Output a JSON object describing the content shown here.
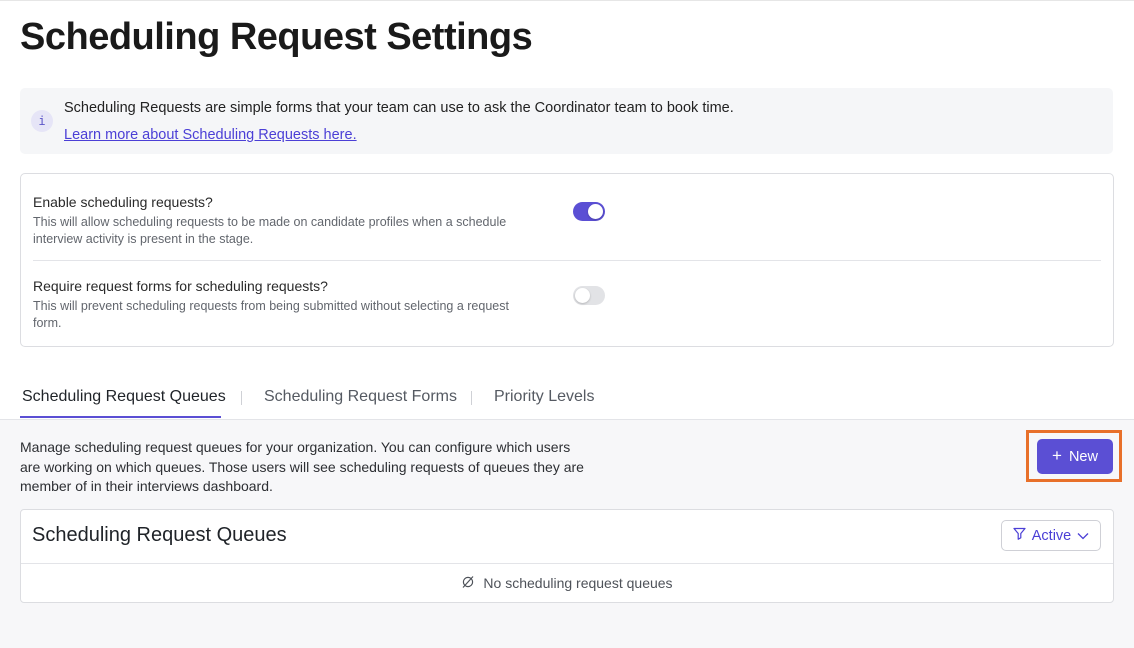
{
  "page": {
    "title": "Scheduling Request Settings"
  },
  "info_banner": {
    "icon": "info-icon",
    "icon_glyph": "i",
    "text": "Scheduling Requests are simple forms that your team can use to ask the Coordinator team to book time.",
    "link_text": "Learn more about Scheduling Requests here."
  },
  "settings": [
    {
      "title": "Enable scheduling requests?",
      "description": "This will allow scheduling requests to be made on candidate profiles when a schedule interview activity is present in the stage.",
      "enabled": true
    },
    {
      "title": "Require request forms for scheduling requests?",
      "description": "This will prevent scheduling requests from being submitted without selecting a request form.",
      "enabled": false
    }
  ],
  "tabs": [
    {
      "label": "Scheduling Request Queues",
      "active": true
    },
    {
      "label": "Scheduling Request Forms",
      "active": false
    },
    {
      "label": "Priority Levels",
      "active": false
    }
  ],
  "queues_section": {
    "description": "Manage scheduling request queues for your organization. You can configure which users are working on which queues. Those users will see scheduling requests of queues they are member of in their interviews dashboard.",
    "new_button": {
      "icon": "plus-icon",
      "label": "New"
    },
    "card_title": "Scheduling Request Queues",
    "filter": {
      "icon": "filter-icon",
      "label": "Active",
      "chevron": "chevron-down-icon"
    },
    "empty_state": {
      "icon": "empty-set-icon",
      "text": "No scheduling request queues"
    }
  },
  "colors": {
    "accent": "#5b4fd4",
    "highlight": "#e8702a",
    "link": "#4b3fd6"
  }
}
